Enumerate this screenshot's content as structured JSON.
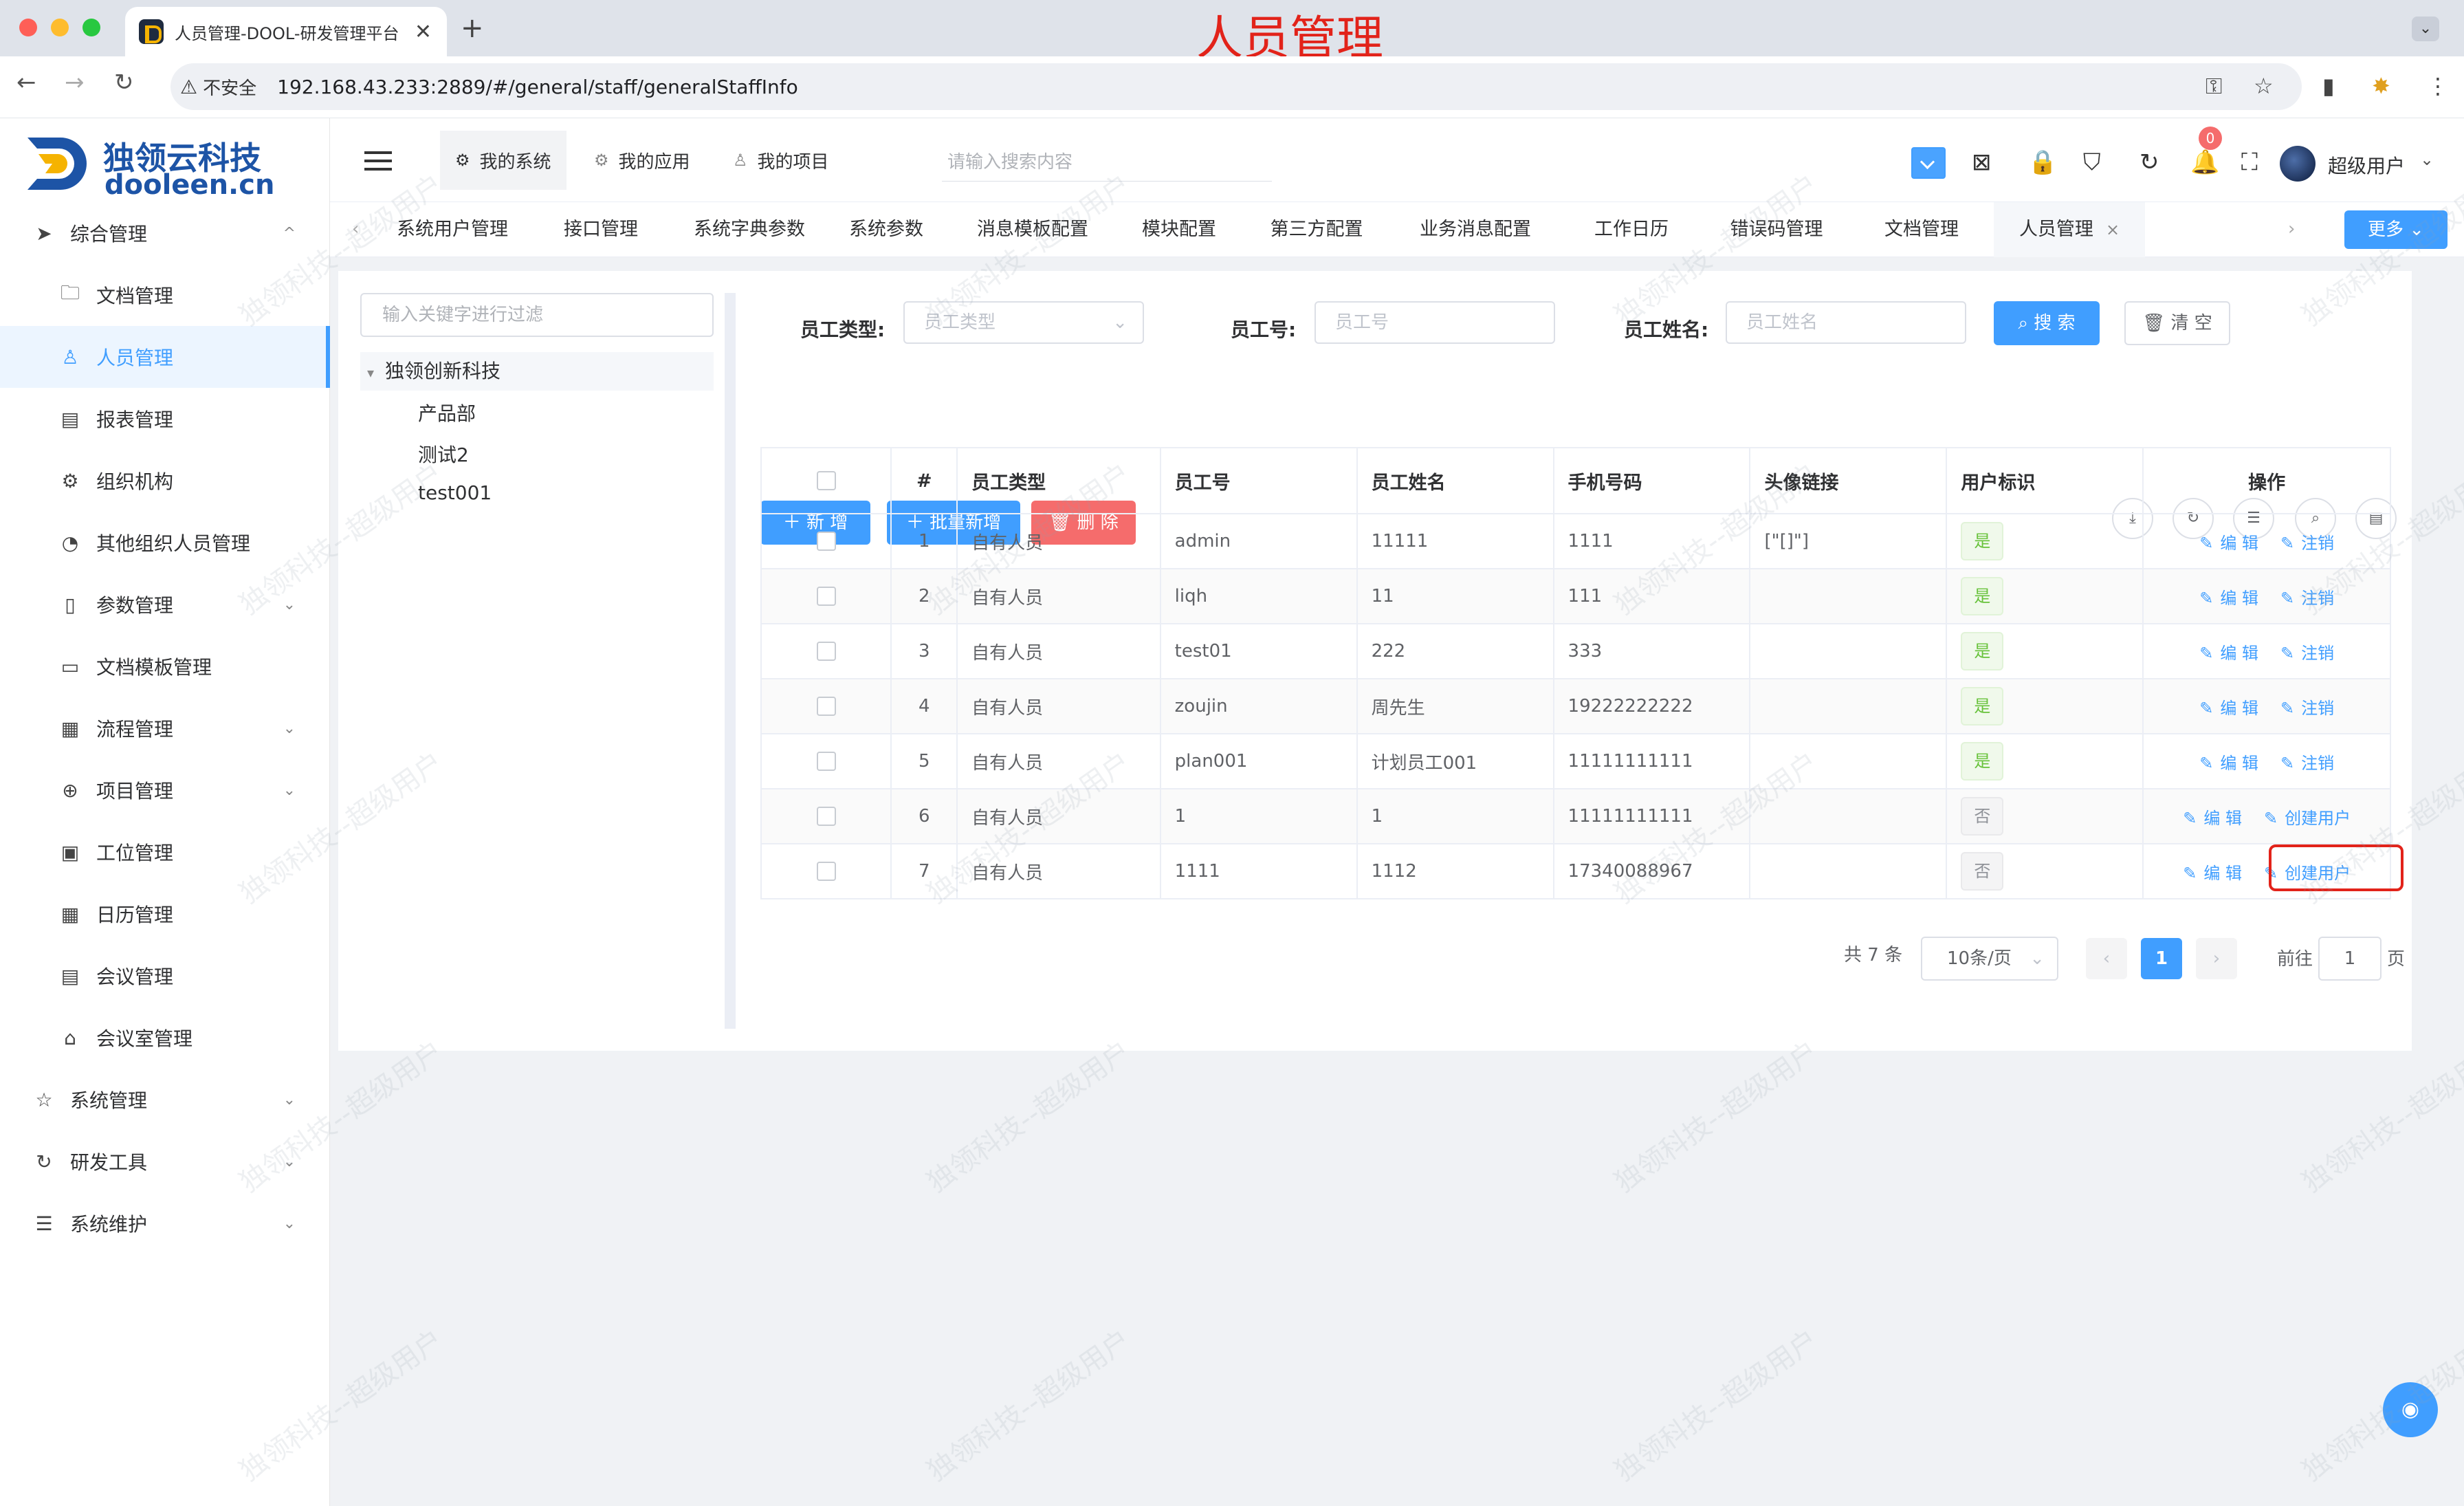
{
  "overlay_title": "人员管理",
  "browser": {
    "tab_title": "人员管理-DOOL-研发管理平台",
    "tab_close": "✕",
    "new_tab": "+",
    "insecure_label": "不安全",
    "url": "192.168.43.233:2889/#/general/staff/generalStaffInfo"
  },
  "logo": {
    "cn": "独领云科技",
    "en": "dooleen.cn"
  },
  "sidebar": {
    "items": [
      {
        "label": "综合管理",
        "icon": "send-icon",
        "glyph": "➤",
        "chevron": "^"
      },
      {
        "label": "文档管理",
        "icon": "folder-icon",
        "glyph": "🗀"
      },
      {
        "label": "人员管理",
        "icon": "user-icon",
        "glyph": "♙"
      },
      {
        "label": "报表管理",
        "icon": "report-icon",
        "glyph": "▤"
      },
      {
        "label": "组织机构",
        "icon": "gear-icon",
        "glyph": "⚙"
      },
      {
        "label": "其他组织人员管理",
        "icon": "dashboard-icon",
        "glyph": "◔"
      },
      {
        "label": "参数管理",
        "icon": "notebook-icon",
        "glyph": "▯",
        "chevron": "⌄"
      },
      {
        "label": "文档模板管理",
        "icon": "box-icon",
        "glyph": "▭"
      },
      {
        "label": "流程管理",
        "icon": "calendar-icon",
        "glyph": "▦",
        "chevron": "⌄"
      },
      {
        "label": "项目管理",
        "icon": "plus-circle-icon",
        "glyph": "⊕",
        "chevron": "⌄"
      },
      {
        "label": "工位管理",
        "icon": "clipboard-icon",
        "glyph": "▣"
      },
      {
        "label": "日历管理",
        "icon": "date-icon",
        "glyph": "▦"
      },
      {
        "label": "会议管理",
        "icon": "document-icon",
        "glyph": "▤"
      },
      {
        "label": "会议室管理",
        "icon": "house-icon",
        "glyph": "⌂"
      },
      {
        "label": "系统管理",
        "icon": "star-icon",
        "glyph": "☆",
        "chevron": "⌄"
      },
      {
        "label": "研发工具",
        "icon": "refresh-icon",
        "glyph": "↻",
        "chevron": "⌄"
      },
      {
        "label": "系统维护",
        "icon": "sliders-icon",
        "glyph": "☰",
        "chevron": "⌄"
      }
    ]
  },
  "header": {
    "tabs": [
      {
        "label": "我的系统",
        "glyph": "⚙"
      },
      {
        "label": "我的应用",
        "glyph": "⚙"
      },
      {
        "label": "我的项目",
        "glyph": "♙"
      }
    ],
    "search_placeholder": "请输入搜索内容",
    "badge_count": "0",
    "user_name": "超级用户"
  },
  "page_tabs": {
    "items": [
      "系统用户管理",
      "接口管理",
      "系统字典参数",
      "系统参数",
      "消息模板配置",
      "模块配置",
      "第三方配置",
      "业务消息配置",
      "工作日历",
      "错误码管理",
      "文档管理",
      "人员管理"
    ],
    "more_label": "更多"
  },
  "tree": {
    "filter_placeholder": "输入关键字进行过滤",
    "root": "独领创新科技",
    "children": [
      "产品部",
      "测试2",
      "test001"
    ]
  },
  "filters": {
    "type_label": "员工类型:",
    "type_placeholder": "员工类型",
    "number_label": "员工号:",
    "number_placeholder": "员工号",
    "name_label": "员工姓名:",
    "name_placeholder": "员工姓名",
    "search_label": "搜 索",
    "clear_label": "清 空"
  },
  "actions": {
    "add_label": "新 增",
    "batch_add_label": "批量新增",
    "delete_label": "删 除"
  },
  "table": {
    "columns": [
      "#",
      "员工类型",
      "员工号",
      "员工姓名",
      "手机号码",
      "头像链接",
      "用户标识",
      "操作"
    ],
    "rows": [
      {
        "index": "1",
        "type": "自有人员",
        "number": "admin",
        "name": "11111",
        "phone": "1111",
        "avatar": "[\"[]\"]",
        "user_flag": "是",
        "op1": "编 辑",
        "op2": "注销"
      },
      {
        "index": "2",
        "type": "自有人员",
        "number": "liqh",
        "name": "11",
        "phone": "111",
        "avatar": "",
        "user_flag": "是",
        "op1": "编 辑",
        "op2": "注销"
      },
      {
        "index": "3",
        "type": "自有人员",
        "number": "test01",
        "name": "222",
        "phone": "333",
        "avatar": "",
        "user_flag": "是",
        "op1": "编 辑",
        "op2": "注销"
      },
      {
        "index": "4",
        "type": "自有人员",
        "number": "zoujin",
        "name": "周先生",
        "phone": "19222222222",
        "avatar": "",
        "user_flag": "是",
        "op1": "编 辑",
        "op2": "注销"
      },
      {
        "index": "5",
        "type": "自有人员",
        "number": "plan001",
        "name": "计划员工001",
        "phone": "11111111111",
        "avatar": "",
        "user_flag": "是",
        "op1": "编 辑",
        "op2": "注销"
      },
      {
        "index": "6",
        "type": "自有人员",
        "number": "1",
        "name": "1",
        "phone": "11111111111",
        "avatar": "",
        "user_flag": "否",
        "op1": "编 辑",
        "op2": "创建用户"
      },
      {
        "index": "7",
        "type": "自有人员",
        "number": "1111",
        "name": "1112",
        "phone": "17340088967",
        "avatar": "",
        "user_flag": "否",
        "op1": "编 辑",
        "op2": "创建用户"
      }
    ]
  },
  "pagination": {
    "total": "共 7 条",
    "page_size": "10条/页",
    "current_page": "1",
    "goto_label": "前往",
    "goto_value": "1",
    "page_suffix": "页"
  },
  "watermark": "独领科技--超级用户",
  "colors": {
    "primary": "#409eff",
    "danger": "#f56c6c",
    "success": "#67c23a",
    "brand": "#1d54a6",
    "annotation": "#e2231a"
  }
}
